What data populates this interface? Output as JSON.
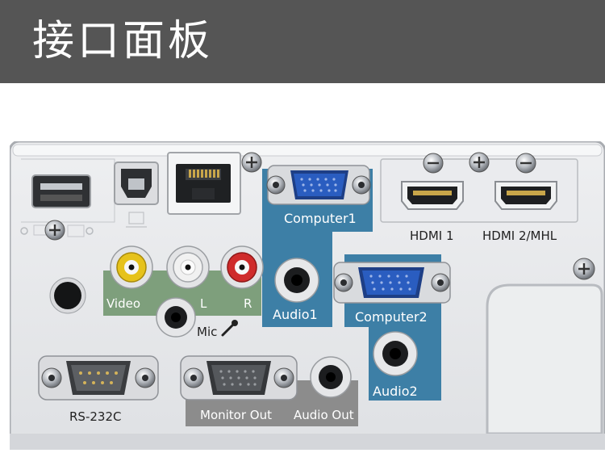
{
  "header": {
    "title": "接口面板"
  },
  "labels": {
    "video": "Video",
    "left": "L",
    "right": "R",
    "mic": "Mic",
    "computer1": "Computer1",
    "audio1": "Audio1",
    "computer2": "Computer2",
    "audio2": "Audio2",
    "hdmi1": "HDMI 1",
    "hdmi2": "HDMI 2/MHL",
    "rs232c": "RS-232C",
    "monitor_out": "Monitor Out",
    "audio_out": "Audio Out"
  },
  "colors": {
    "header_bg": "#555555",
    "blue_zone": "#3d7fa6",
    "green_zone": "#7e9f7c",
    "gray_zone": "#8c8c8c",
    "vga_blue": "#2a5dc0",
    "panel_gray": "#e6e7ea"
  }
}
